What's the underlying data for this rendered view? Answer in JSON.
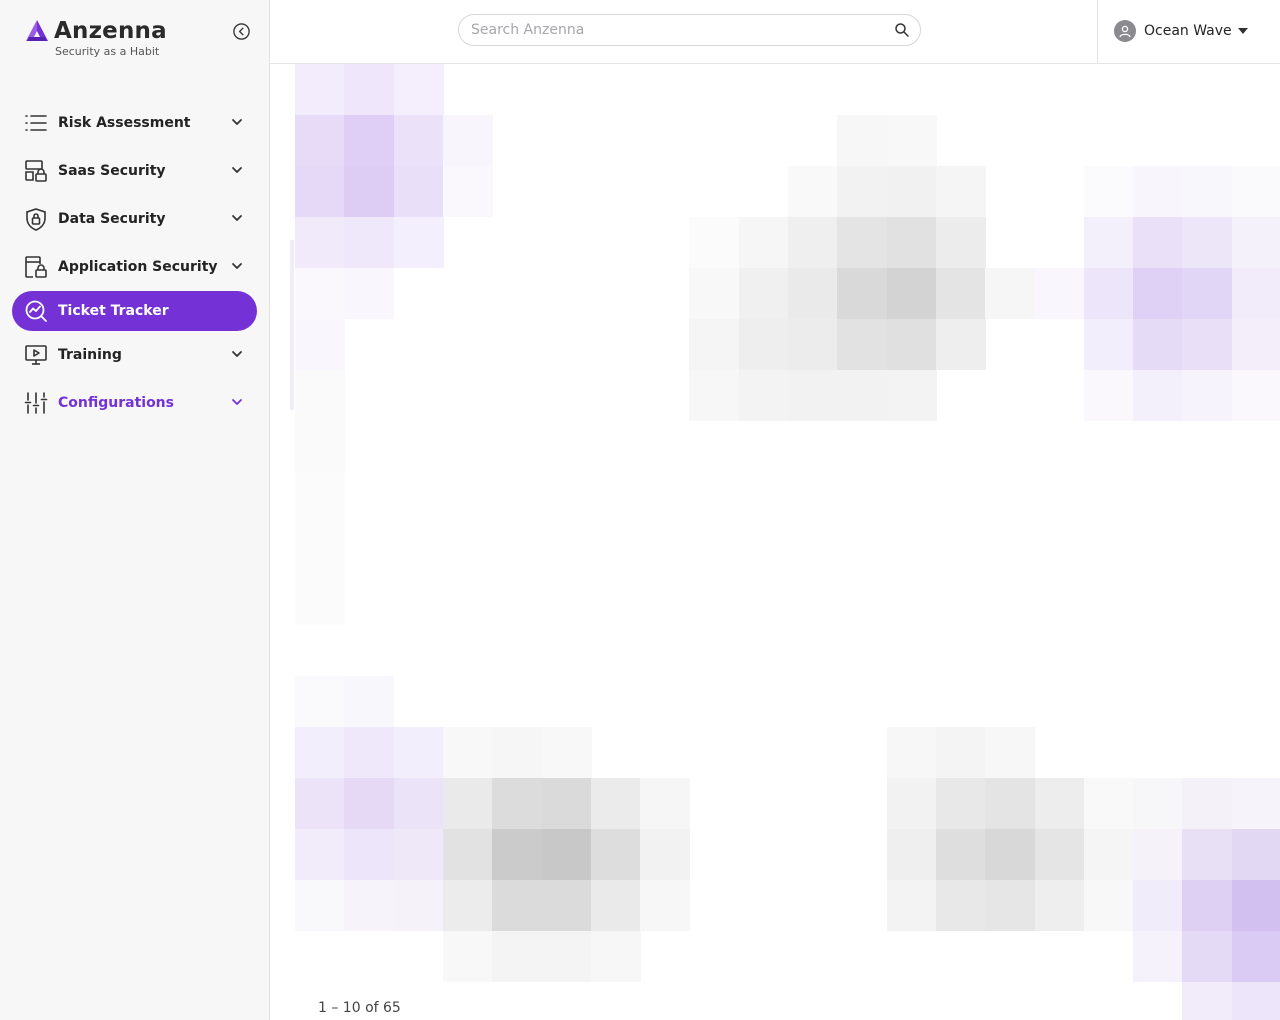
{
  "brand": {
    "name": "Anzenna",
    "tagline": "Security as a Habit"
  },
  "sidebar": {
    "items": [
      {
        "label": "Risk Assessment",
        "icon": "list-icon",
        "expandable": true
      },
      {
        "label": "Saas Security",
        "icon": "saas-lock-icon",
        "expandable": true
      },
      {
        "label": "Data Security",
        "icon": "shield-lock-icon",
        "expandable": true
      },
      {
        "label": "Application Security",
        "icon": "app-lock-icon",
        "expandable": true
      },
      {
        "label": "Ticket Tracker",
        "icon": "chart-search-icon",
        "expandable": false,
        "active": true
      },
      {
        "label": "Training",
        "icon": "monitor-play-icon",
        "expandable": true
      },
      {
        "label": "Configurations",
        "icon": "sliders-icon",
        "expandable": true,
        "highlighted": true
      }
    ]
  },
  "header": {
    "search_placeholder": "Search Anzenna",
    "user_name": "Ocean Wave"
  },
  "main": {
    "pagination_text": "1 – 10 of 65"
  },
  "colors": {
    "accent": "#7431d5",
    "sidebar_bg": "#f7f7f8"
  }
}
